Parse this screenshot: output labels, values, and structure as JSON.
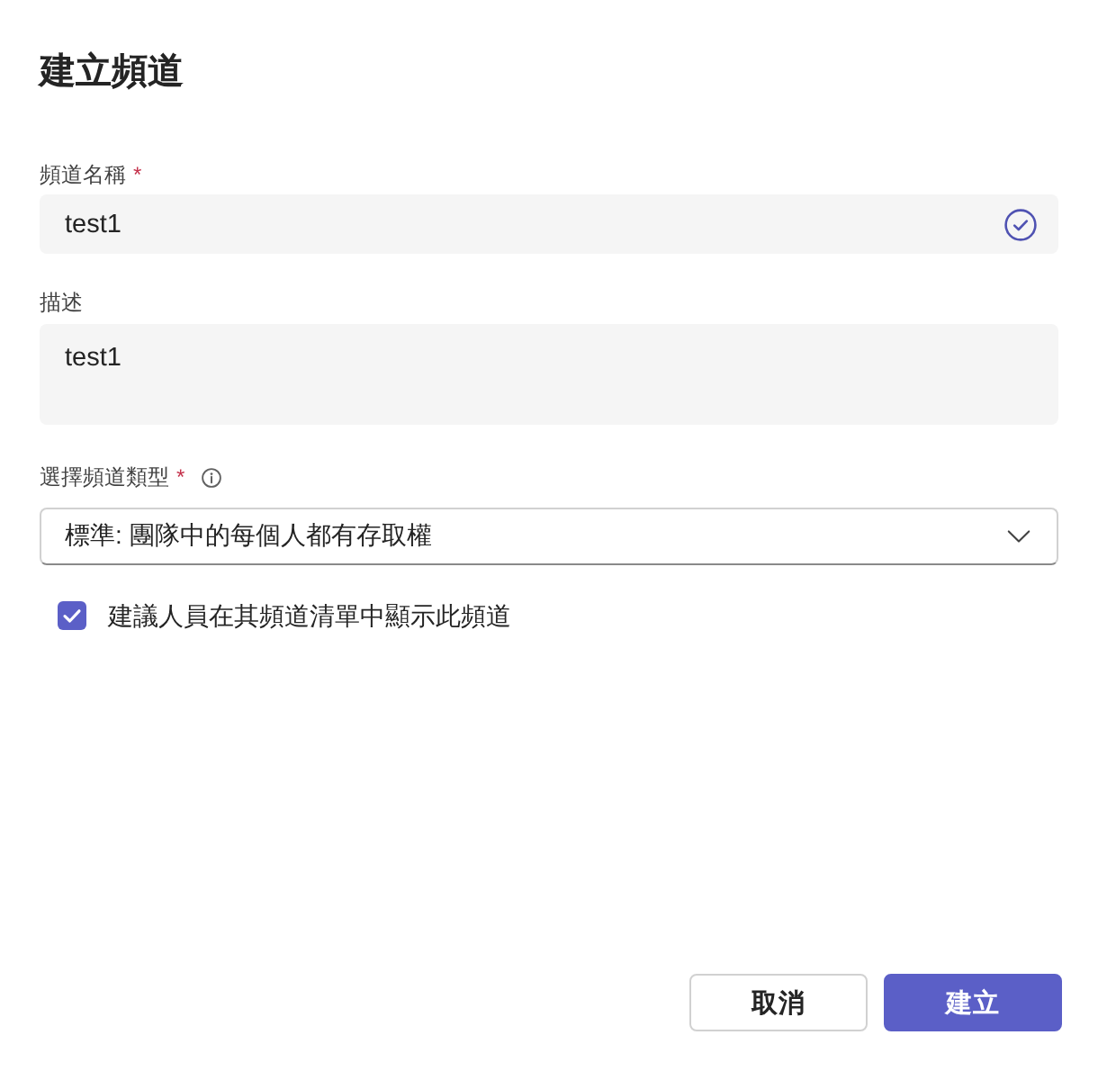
{
  "dialog": {
    "title": "建立頻道"
  },
  "fields": [
    {
      "kind": "text",
      "label": "頻道名稱",
      "required_mark": "*",
      "value": "test1",
      "valid": true
    },
    {
      "kind": "textarea",
      "label": "描述",
      "value": "test1"
    },
    {
      "kind": "select",
      "label": "選擇頻道類型",
      "required_mark": "*",
      "info": true,
      "value": "標準: 團隊中的每個人都有存取權"
    }
  ],
  "checkbox": {
    "label": "建議人員在其頻道清單中顯示此頻道",
    "checked": true
  },
  "buttons": [
    {
      "label": "取消",
      "kind": "secondary"
    },
    {
      "label": "建立",
      "kind": "primary"
    }
  ]
}
